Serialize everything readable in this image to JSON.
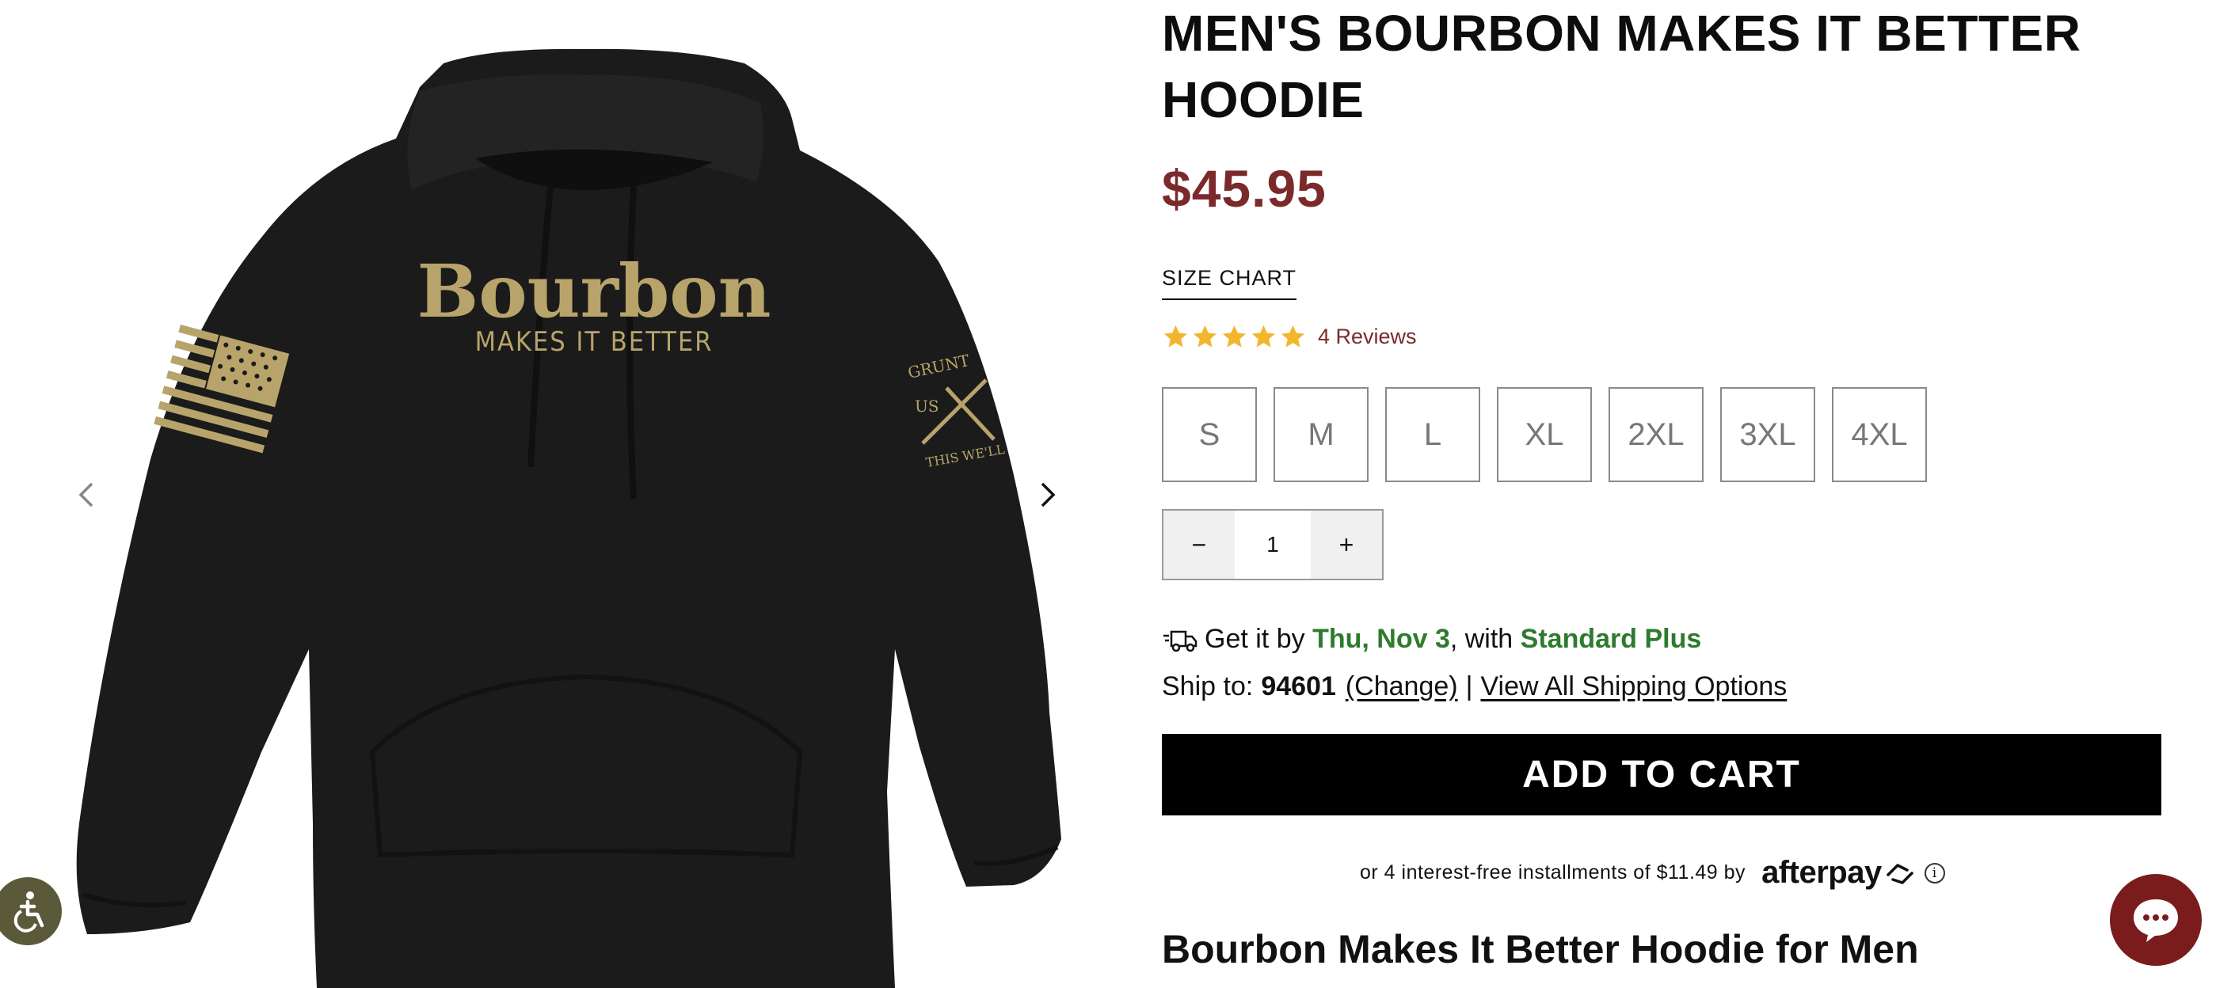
{
  "product": {
    "title": "MEN'S BOURBON MAKES IT BETTER HOODIE",
    "price": "$45.95",
    "size_chart_label": "SIZE CHART",
    "rating": 5,
    "reviews_label": "4 Reviews",
    "sizes": [
      "S",
      "M",
      "L",
      "XL",
      "2XL",
      "3XL",
      "4XL"
    ],
    "quantity": "1",
    "qty_minus": "−",
    "qty_plus": "+"
  },
  "shipping": {
    "get_it_by": "Get it by",
    "date": "Thu, Nov 3",
    "with": ", with",
    "method": "Standard Plus",
    "ship_to_label": "Ship to:",
    "zip": "94601",
    "change_label": "(Change)",
    "separator": "|",
    "all_options_label": "View All Shipping Options"
  },
  "cart": {
    "add_to_cart_label": "ADD TO CART"
  },
  "afterpay": {
    "text": "or 4 interest-free installments of $11.49 by",
    "logo_text": "afterpay",
    "info_glyph": "i"
  },
  "description": {
    "heading": "Bourbon Makes It Better Hoodie for Men"
  },
  "gallery": {
    "print_main": "Bourbon",
    "print_sub": "MAKES IT BETTER",
    "sleeve_text_top": "GRUNT",
    "sleeve_text_mid": "US",
    "sleeve_text_bottom": "THIS WE'LL"
  },
  "colors": {
    "price": "#7a2a2a",
    "accent_green": "#2e7a2e",
    "star": "#f2b62c",
    "print_tan": "#b8a46a",
    "hoodie": "#1b1b1b",
    "chat": "#7a1c1c",
    "a11y": "#5a5a3a"
  },
  "icons": {
    "prev": "chevron-left-icon",
    "next": "chevron-right-icon",
    "accessibility": "accessibility-icon",
    "truck": "truck-icon",
    "chat": "chat-bubble-icon",
    "star": "star-icon",
    "info": "info-icon"
  }
}
